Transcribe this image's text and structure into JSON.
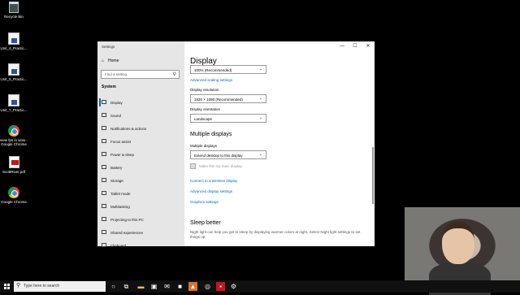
{
  "desktop": {
    "icons": [
      {
        "label": "Recycle Bin",
        "icon": "recycle-bin-icon"
      },
      {
        "label": "Unit_4_Practic...",
        "icon": "document-icon"
      },
      {
        "label": "Unit_5_Practic...",
        "icon": "document-icon"
      },
      {
        "label": "Unit_7_Practic...",
        "icon": "document-icon"
      },
      {
        "label": "view fps in wow - Google Chrome",
        "icon": "chrome-icon"
      },
      {
        "label": "ScottRiver.pdf",
        "icon": "pdf-icon"
      },
      {
        "label": "Google Chrome",
        "icon": "chrome-icon"
      }
    ]
  },
  "window": {
    "title": "Settings",
    "controls": {
      "minimize": "—",
      "maximize": "☐",
      "close": "✕"
    }
  },
  "sidebar": {
    "home": "Home",
    "search_placeholder": "Find a setting",
    "section": "System",
    "items": [
      {
        "label": "Display",
        "active": true
      },
      {
        "label": "Sound"
      },
      {
        "label": "Notifications & actions"
      },
      {
        "label": "Focus assist"
      },
      {
        "label": "Power & sleep"
      },
      {
        "label": "Battery"
      },
      {
        "label": "Storage"
      },
      {
        "label": "Tablet mode"
      },
      {
        "label": "Multitasking"
      },
      {
        "label": "Projecting to this PC"
      },
      {
        "label": "Shared experiences"
      },
      {
        "label": "Clipboard"
      }
    ]
  },
  "main": {
    "heading": "Display",
    "scale_value": "100% (Recommended)",
    "advanced_scaling_link": "Advanced scaling settings",
    "resolution_label": "Display resolution",
    "resolution_value": "1920 × 1080 (Recommended)",
    "orientation_label": "Display orientation",
    "orientation_value": "Landscape",
    "multiple_heading": "Multiple displays",
    "multiple_label": "Multiple displays",
    "multiple_value": "Extend desktop to this display",
    "main_display_checkbox": "Make this my main display",
    "connect_link": "Connect to a wireless display",
    "advanced_display_link": "Advanced display settings",
    "graphics_link": "Graphics settings",
    "sleep_heading": "Sleep better",
    "sleep_text": "Night light can help you get to sleep by displaying warmer colors at night. Select Night light settings to set things up."
  },
  "taskbar": {
    "search_placeholder": "Type here to search"
  }
}
